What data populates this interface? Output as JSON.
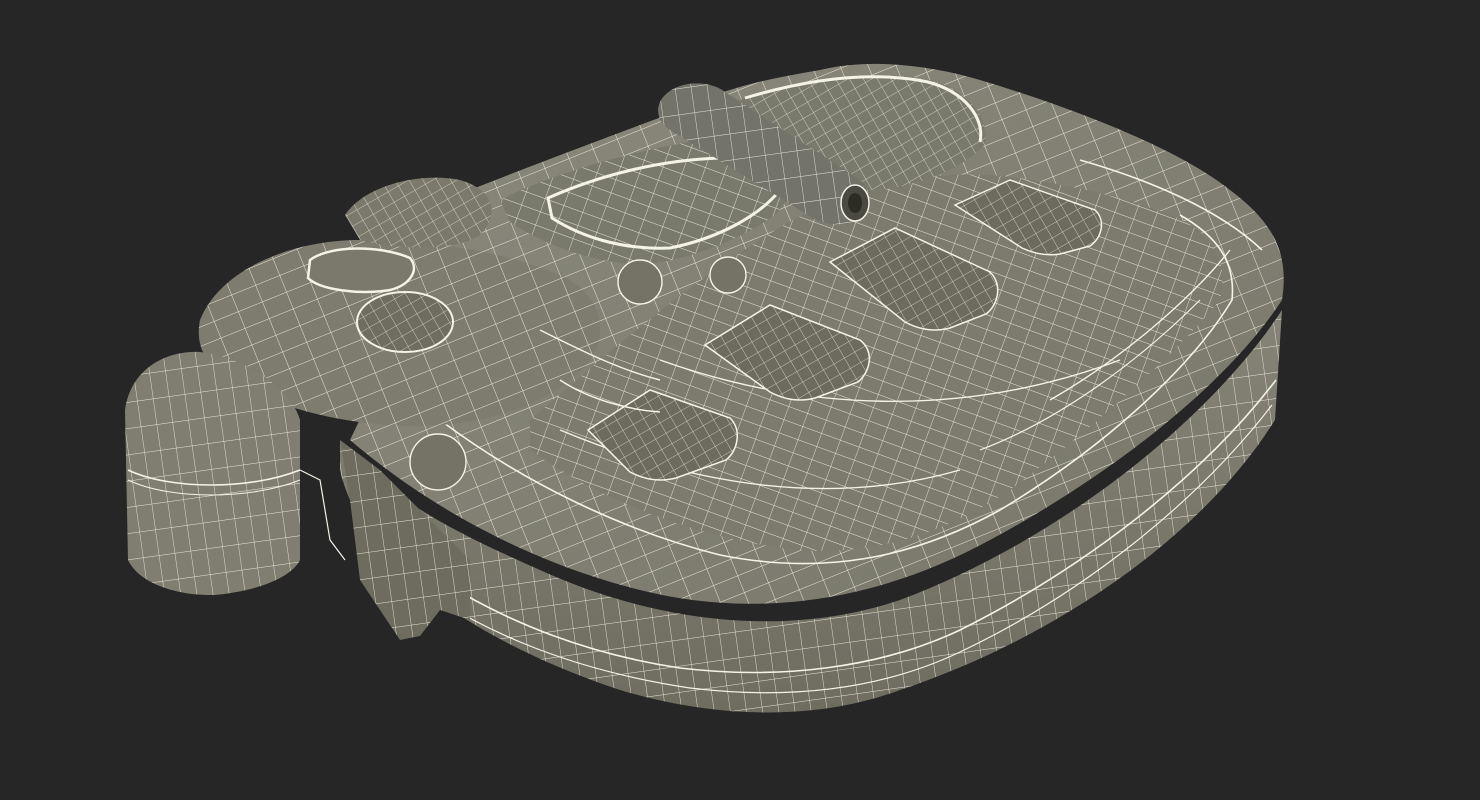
{
  "scene": {
    "background_color": "#262626",
    "surface_color": "#7d7c6f",
    "surface_shadow_color": "#666557",
    "surface_highlight_color": "#8e8d80",
    "wire_color": "#f4f3e6",
    "subject": "wireframe-3d-model"
  }
}
